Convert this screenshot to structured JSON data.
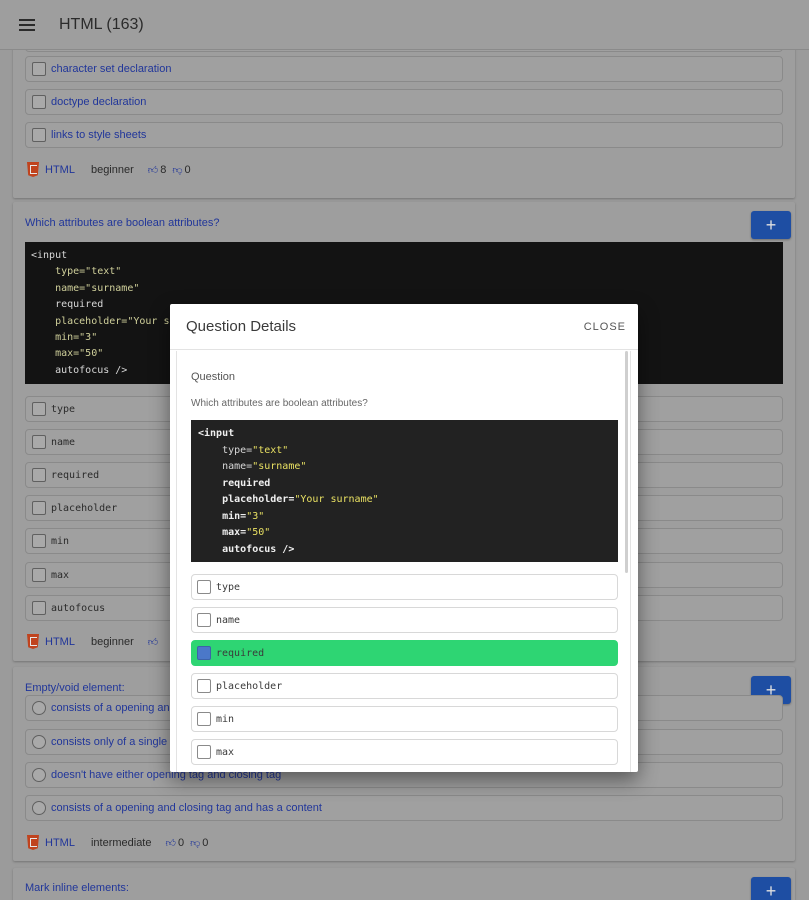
{
  "appbar": {
    "title": "HTML (163)"
  },
  "card1": {
    "options": [
      "character set declaration",
      "doctype declaration",
      "links to style sheets"
    ],
    "meta": {
      "lang": "HTML",
      "level": "beginner",
      "likes": "8",
      "dislikes": "0"
    }
  },
  "card2": {
    "question": "Which attributes are boolean attributes?",
    "add_label": "+",
    "code": [
      "<input",
      "    type=\"text\"",
      "    name=\"surname\"",
      "    required",
      "    placeholder=\"Your s",
      "    min=\"3\"",
      "    max=\"50\"",
      "    autofocus />"
    ],
    "options": [
      "type",
      "name",
      "required",
      "placeholder",
      "min",
      "max",
      "autofocus"
    ],
    "meta": {
      "lang": "HTML",
      "level": "beginner"
    }
  },
  "card3": {
    "question": "Empty/void element:",
    "add_label": "+",
    "options": [
      "consists of a opening and",
      "consists only of a single t",
      "doesn't have either opening tag and closing tag",
      "consists of a opening and closing tag and has a content"
    ],
    "meta": {
      "lang": "HTML",
      "level": "intermediate",
      "likes": "0",
      "dislikes": "0"
    }
  },
  "card4": {
    "question": "Mark inline elements:",
    "add_label": "+"
  },
  "dialog": {
    "title": "Question Details",
    "close_label": "CLOSE",
    "section_label": "Question",
    "question": "Which attributes are boolean attributes?",
    "code": {
      "line1": "<input",
      "type_attr": "type=",
      "type_val": "\"text\"",
      "name_attr": "name=",
      "name_val": "\"surname\"",
      "required": "required",
      "placeholder_attr": "placeholder=",
      "placeholder_val": "\"Your surname\"",
      "min_attr": "min=",
      "min_val": "\"3\"",
      "max_attr": "max=",
      "max_val": "\"50\"",
      "autofocus": "autofocus />"
    },
    "options": [
      {
        "label": "type",
        "checked": false
      },
      {
        "label": "name",
        "checked": false
      },
      {
        "label": "required",
        "checked": true
      },
      {
        "label": "placeholder",
        "checked": false
      },
      {
        "label": "min",
        "checked": false
      },
      {
        "label": "max",
        "checked": false
      }
    ]
  },
  "colors": {
    "primary": "#1e4ea3",
    "correct": "#2ed573",
    "link": "#21369a"
  },
  "icons": {
    "menu": "hamburger-menu-icon",
    "lang": "html5-icon",
    "like": "thumbs-up-icon",
    "dislike": "thumbs-down-icon"
  }
}
